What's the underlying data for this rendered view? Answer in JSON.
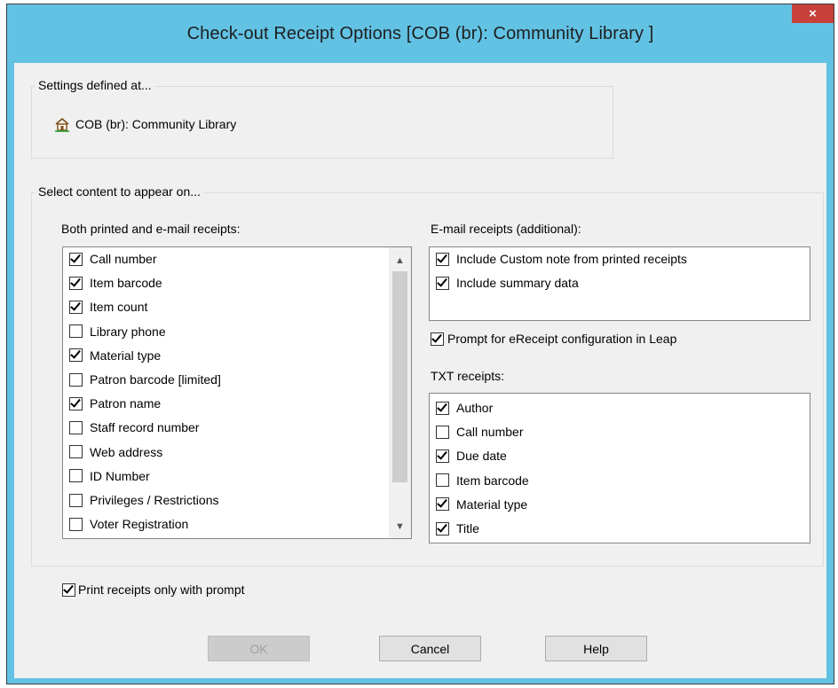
{
  "window": {
    "title": "Check-out Receipt Options [COB (br): Community Library ]",
    "close": "×"
  },
  "settings": {
    "legend": "Settings defined at...",
    "location": "COB (br): Community Library"
  },
  "content": {
    "legend": "Select content to appear on...",
    "both": {
      "label": "Both printed and e-mail receipts:",
      "items": [
        {
          "label": "Call number",
          "checked": true
        },
        {
          "label": "Item barcode",
          "checked": true
        },
        {
          "label": "Item count",
          "checked": true
        },
        {
          "label": "Library phone",
          "checked": false
        },
        {
          "label": "Material type",
          "checked": true
        },
        {
          "label": "Patron barcode [limited]",
          "checked": false
        },
        {
          "label": "Patron name",
          "checked": true
        },
        {
          "label": "Staff record number",
          "checked": false
        },
        {
          "label": "Web address",
          "checked": false
        },
        {
          "label": "ID Number",
          "checked": false
        },
        {
          "label": "Privileges / Restrictions",
          "checked": false
        },
        {
          "label": "Voter Registration",
          "checked": false
        }
      ]
    },
    "email": {
      "label": "E-mail receipts (additional):",
      "items": [
        {
          "label": "Include Custom note from printed receipts",
          "checked": true
        },
        {
          "label": "Include summary data",
          "checked": true
        }
      ]
    },
    "prompt_ereceipt": {
      "label": "Prompt for eReceipt configuration in Leap",
      "checked": true
    },
    "txt": {
      "label": "TXT receipts:",
      "items": [
        {
          "label": "Author",
          "checked": true
        },
        {
          "label": "Call number",
          "checked": false
        },
        {
          "label": "Due date",
          "checked": true
        },
        {
          "label": "Item barcode",
          "checked": false
        },
        {
          "label": "Material type",
          "checked": true
        },
        {
          "label": "Title",
          "checked": true
        }
      ]
    }
  },
  "print_prompt": {
    "label": "Print receipts only with prompt",
    "checked": true
  },
  "buttons": {
    "ok": "OK",
    "cancel": "Cancel",
    "help": "Help"
  },
  "colors": {
    "titlebar": "#62c2e4",
    "close": "#c7403a",
    "dialog_bg": "#f0f0f0"
  }
}
